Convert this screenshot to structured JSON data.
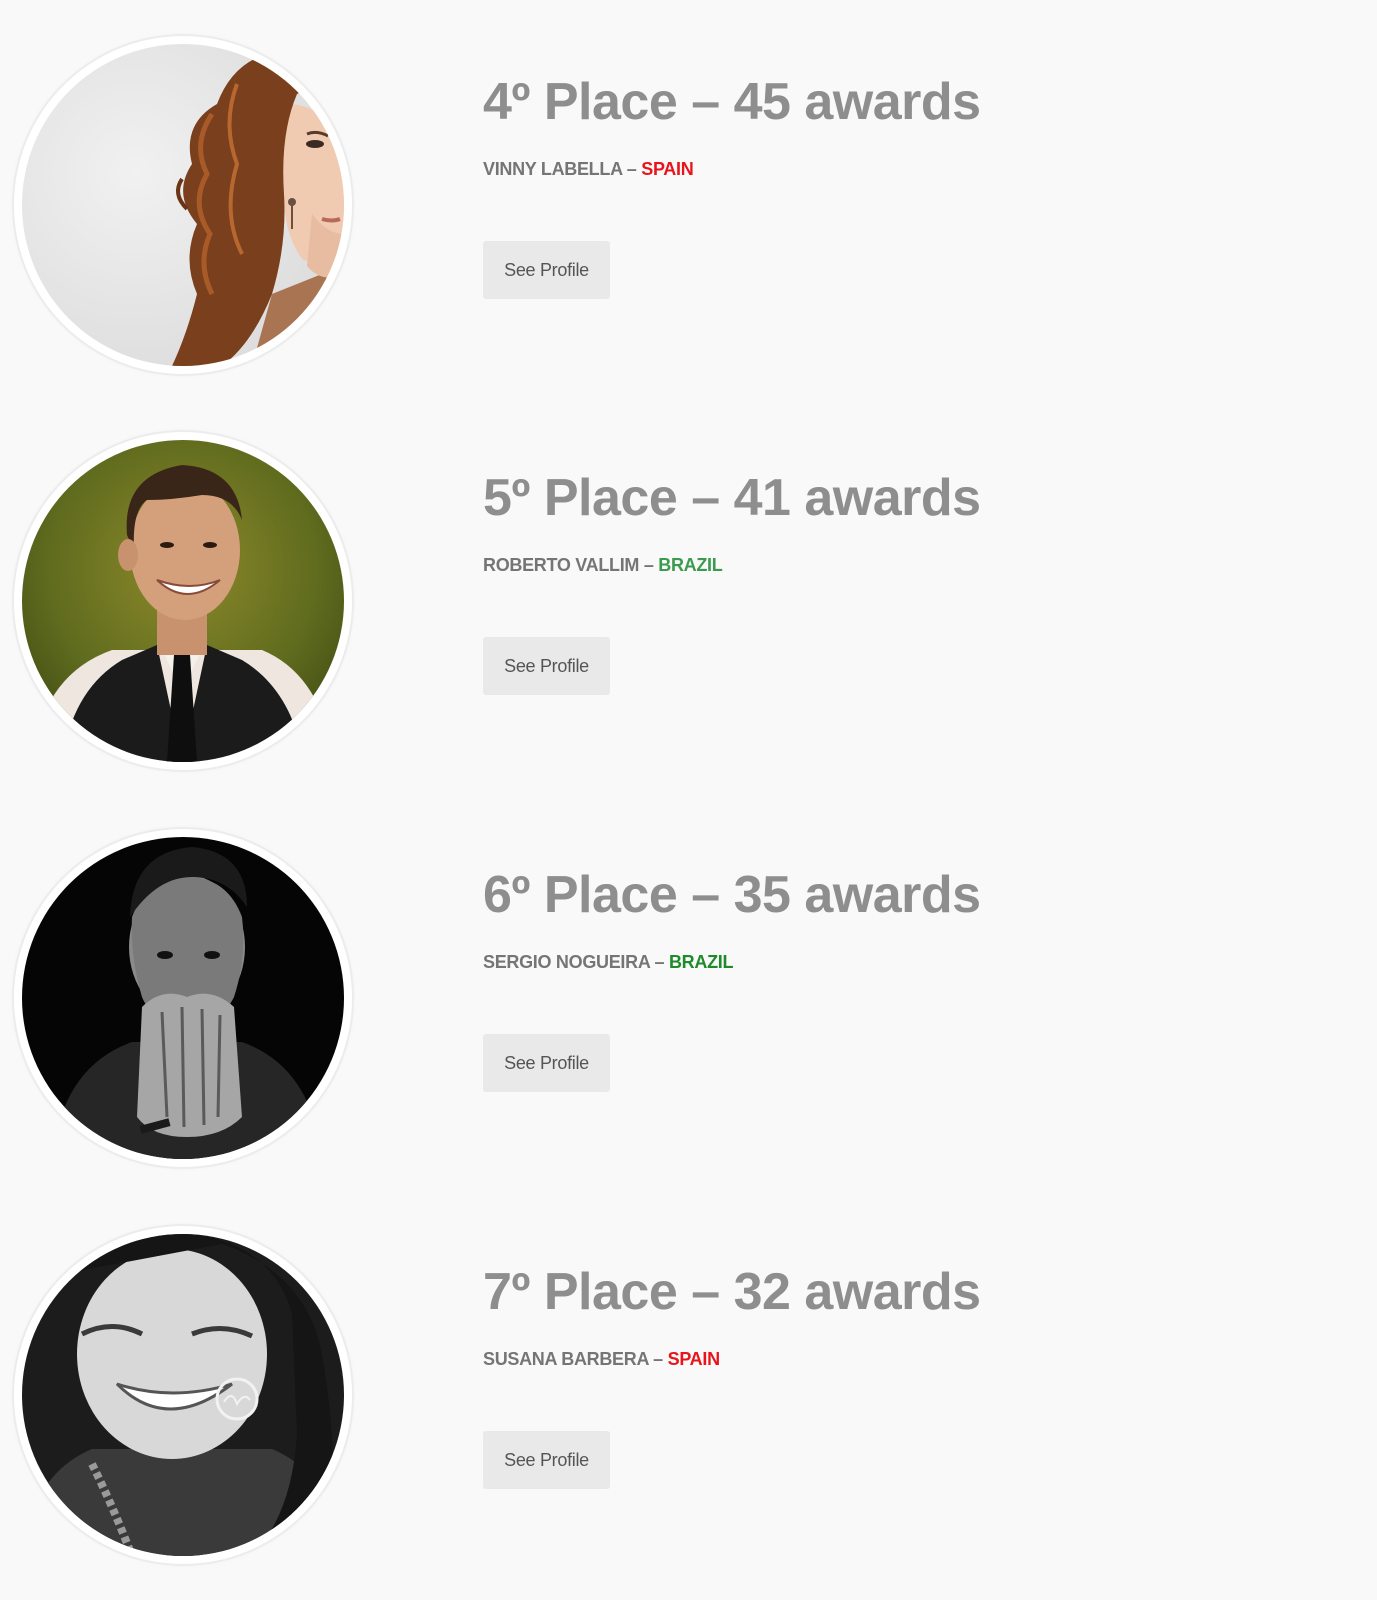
{
  "entries": [
    {
      "place": "4º Place – 45 awards",
      "name": "VINNY LABELLA",
      "separator": " – ",
      "country": "SPAIN",
      "country_color": "#e8141b",
      "button_label": "See Profile",
      "photo": "woman-curly-hair-photo"
    },
    {
      "place": "5º Place – 41 awards",
      "name": "ROBERTO VALLIM",
      "separator": " – ",
      "country": "BRAZIL",
      "country_color": "#3a9a4e",
      "button_label": "See Profile",
      "photo": "smiling-man-vest-photo"
    },
    {
      "place": "6º Place – 35 awards",
      "name": "SERGIO NOGUEIRA",
      "separator": " – ",
      "country": "BRAZIL",
      "country_color": "#1e8a2a",
      "button_label": "See Profile",
      "photo": "man-black-white-photo"
    },
    {
      "place": "7º Place – 32 awards",
      "name": "SUSANA BARBERA",
      "separator": " – ",
      "country": "SPAIN",
      "country_color": "#e8141b",
      "button_label": "See Profile",
      "photo": "laughing-woman-black-white-photo"
    }
  ]
}
